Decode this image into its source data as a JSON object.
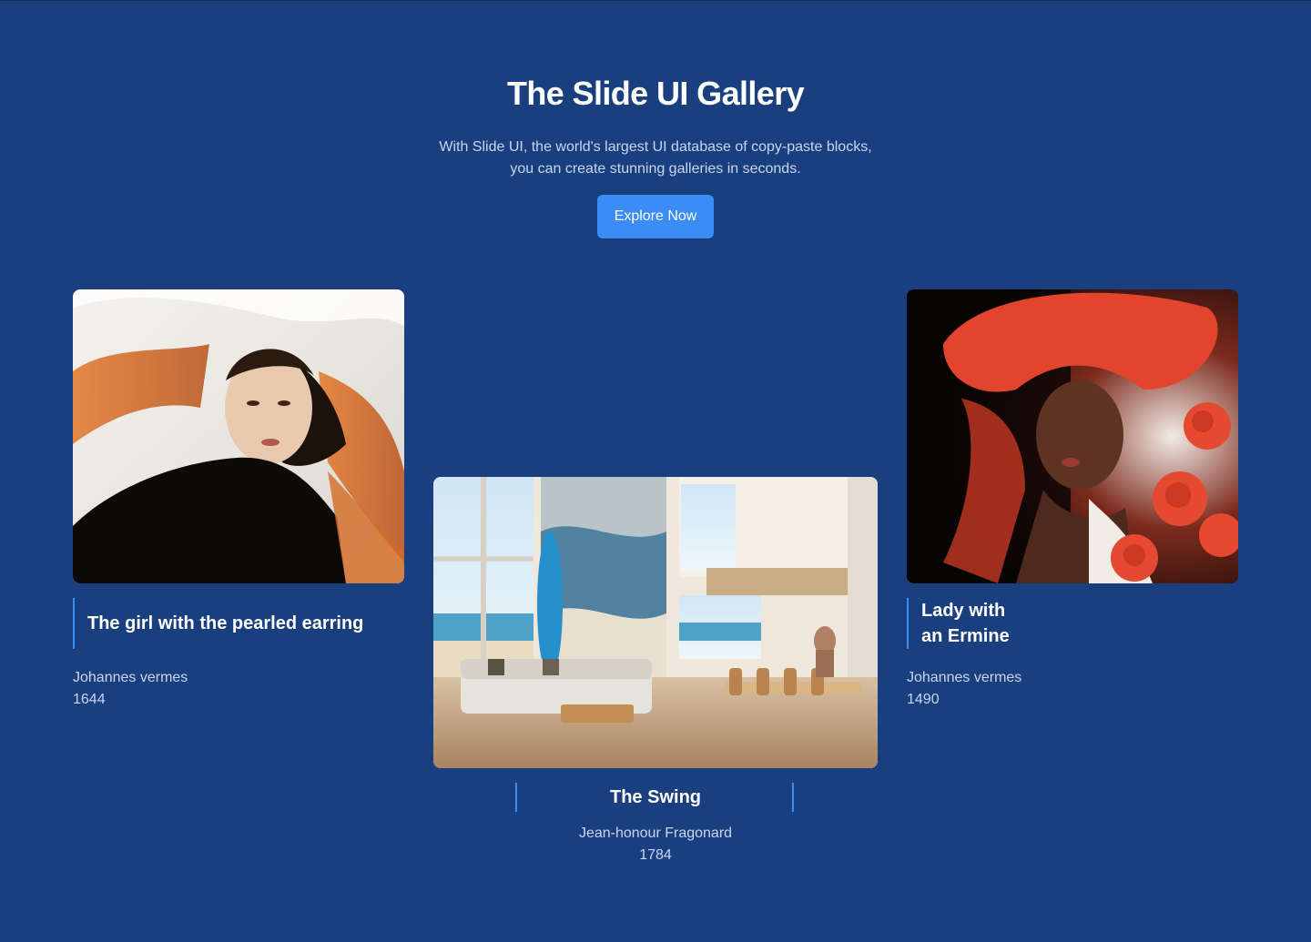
{
  "hero": {
    "title": "The Slide UI Gallery",
    "subtitle_line1": "With Slide UI, the world's largest UI database of copy-paste blocks,",
    "subtitle_line2": "you can create stunning galleries in seconds.",
    "cta_label": "Explore Now"
  },
  "colors": {
    "background": "#1a3f7e",
    "accent": "#3b8cf5",
    "muted_text": "#c9d6f2"
  },
  "gallery": [
    {
      "title": "The girl with the pearled earring",
      "artist": "Johannes vermes",
      "year": "1644",
      "image_icon": "portrait-woman-flowing-hair"
    },
    {
      "title": "The Swing",
      "artist": "Jean-honour Fragonard",
      "year": "1784",
      "image_icon": "beach-house-interior"
    },
    {
      "title_line1": "Lady with",
      "title_line2": "an Ermine",
      "artist": "Johannes vermes",
      "year": "1490",
      "image_icon": "portrait-woman-red-hat-roses"
    }
  ]
}
